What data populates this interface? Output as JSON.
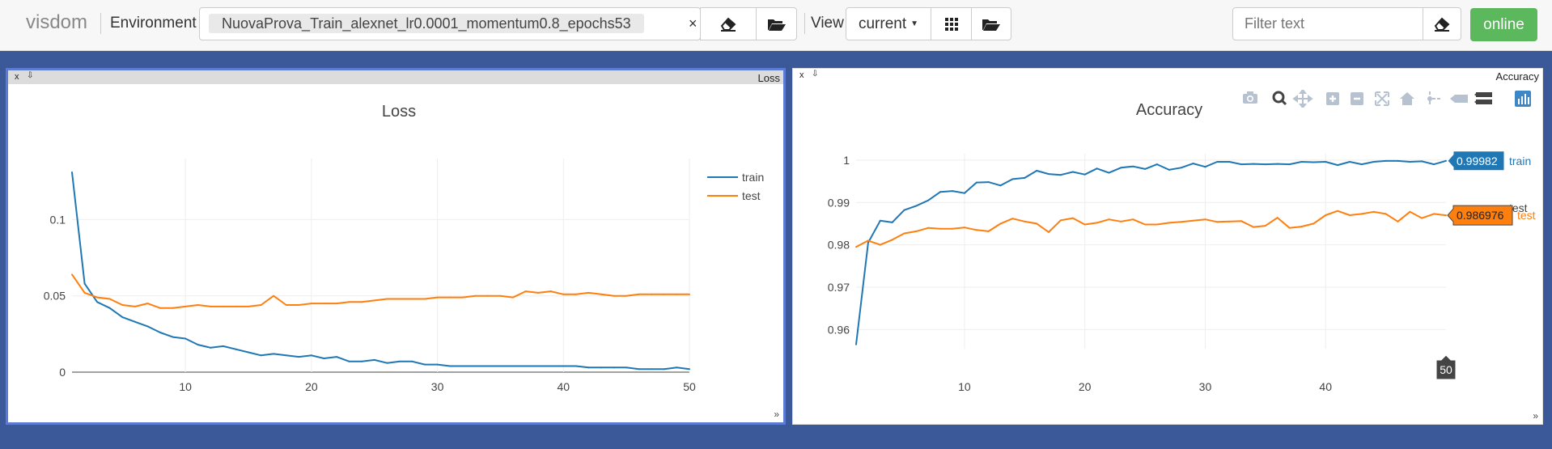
{
  "navbar": {
    "brand": "visdom",
    "environment_label": "Environment",
    "environment_value": "NuovaProva_Train_alexnet_lr0.0001_momentum0.8_epochs53",
    "clear_symbol": "×",
    "view_label": "View",
    "view_value": "current",
    "filter_placeholder": "Filter text",
    "online_label": "online"
  },
  "panels": [
    {
      "title": "Loss",
      "close": "x"
    },
    {
      "title": "Accuracy",
      "close": "x"
    }
  ],
  "colors": {
    "train": "#1f77b4",
    "test": "#ff7f0e",
    "background": "#3b5998",
    "online": "#5cb85c"
  },
  "icons": [
    "eraser-icon",
    "folder-open-icon",
    "grid-icon",
    "camera-icon",
    "zoom-icon",
    "pan-icon",
    "zoom-in-icon",
    "zoom-out-icon",
    "autoscale-icon",
    "home-icon",
    "spike-lines-icon",
    "hover-closest-icon",
    "hover-compare-icon",
    "plotly-logo-icon"
  ],
  "chart_data": [
    {
      "type": "line",
      "title": "Loss",
      "xlim": [
        1,
        50
      ],
      "ylim": [
        0,
        0.14
      ],
      "xticks": [
        10,
        20,
        30,
        40,
        50
      ],
      "yticks": [
        0,
        0.05,
        0.1
      ],
      "ytick_labels": [
        "0",
        "0.05",
        "0.1"
      ],
      "grid": true,
      "legend": "top-right",
      "x": [
        1,
        2,
        3,
        4,
        5,
        6,
        7,
        8,
        9,
        10,
        11,
        12,
        13,
        14,
        15,
        16,
        17,
        18,
        19,
        20,
        21,
        22,
        23,
        24,
        25,
        26,
        27,
        28,
        29,
        30,
        31,
        32,
        33,
        34,
        35,
        36,
        37,
        38,
        39,
        40,
        41,
        42,
        43,
        44,
        45,
        46,
        47,
        48,
        49,
        50
      ],
      "series": [
        {
          "name": "train",
          "values": [
            0.131,
            0.058,
            0.046,
            0.042,
            0.036,
            0.033,
            0.03,
            0.026,
            0.023,
            0.022,
            0.018,
            0.016,
            0.017,
            0.015,
            0.013,
            0.011,
            0.012,
            0.011,
            0.01,
            0.011,
            0.009,
            0.01,
            0.007,
            0.007,
            0.008,
            0.006,
            0.007,
            0.007,
            0.005,
            0.005,
            0.004,
            0.004,
            0.004,
            0.004,
            0.004,
            0.004,
            0.004,
            0.004,
            0.004,
            0.004,
            0.004,
            0.003,
            0.003,
            0.003,
            0.003,
            0.002,
            0.002,
            0.002,
            0.003,
            0.002
          ]
        },
        {
          "name": "test",
          "values": [
            0.064,
            0.052,
            0.049,
            0.048,
            0.044,
            0.043,
            0.045,
            0.042,
            0.042,
            0.043,
            0.044,
            0.043,
            0.043,
            0.043,
            0.043,
            0.044,
            0.05,
            0.044,
            0.044,
            0.045,
            0.045,
            0.045,
            0.046,
            0.046,
            0.047,
            0.048,
            0.048,
            0.048,
            0.048,
            0.049,
            0.049,
            0.049,
            0.05,
            0.05,
            0.05,
            0.049,
            0.053,
            0.052,
            0.053,
            0.051,
            0.051,
            0.052,
            0.051,
            0.05,
            0.05,
            0.051,
            0.051,
            0.051,
            0.051,
            0.051
          ]
        }
      ]
    },
    {
      "type": "line",
      "title": "Accuracy",
      "xlim": [
        1,
        50
      ],
      "ylim": [
        0.9555,
        1.0015
      ],
      "xticks": [
        10,
        20,
        30,
        40
      ],
      "yticks": [
        0.96,
        0.97,
        0.98,
        0.99,
        1
      ],
      "ytick_labels": [
        "0.96",
        "0.97",
        "0.98",
        "0.99",
        "1"
      ],
      "grid": true,
      "legend": "right",
      "hover_x_label": "50",
      "x": [
        1,
        2,
        3,
        4,
        5,
        6,
        7,
        8,
        9,
        10,
        11,
        12,
        13,
        14,
        15,
        16,
        17,
        18,
        19,
        20,
        21,
        22,
        23,
        24,
        25,
        26,
        27,
        28,
        29,
        30,
        31,
        32,
        33,
        34,
        35,
        36,
        37,
        38,
        39,
        40,
        41,
        42,
        43,
        44,
        45,
        46,
        47,
        48,
        49,
        50
      ],
      "series": [
        {
          "name": "train",
          "hover_value": "0.99982",
          "values": [
            0.9565,
            0.9805,
            0.9857,
            0.9853,
            0.9882,
            0.9892,
            0.9905,
            0.9925,
            0.9927,
            0.9922,
            0.9947,
            0.9948,
            0.994,
            0.9955,
            0.9958,
            0.9975,
            0.9967,
            0.9965,
            0.9972,
            0.9966,
            0.998,
            0.997,
            0.9982,
            0.9985,
            0.9979,
            0.999,
            0.9977,
            0.9982,
            0.9992,
            0.9984,
            0.9996,
            0.9996,
            0.999,
            0.9991,
            0.999,
            0.9991,
            0.999,
            0.9996,
            0.9995,
            0.9996,
            0.9988,
            0.9996,
            0.999,
            0.9996,
            0.9998,
            0.9998,
            0.9996,
            0.9997,
            0.999,
            0.99982
          ]
        },
        {
          "name": "test",
          "hover_value": "0.986976",
          "values": [
            0.9795,
            0.981,
            0.98,
            0.9812,
            0.9827,
            0.9832,
            0.984,
            0.9838,
            0.9838,
            0.9841,
            0.9835,
            0.9832,
            0.985,
            0.9862,
            0.9855,
            0.985,
            0.983,
            0.9858,
            0.9863,
            0.9848,
            0.9852,
            0.986,
            0.9855,
            0.986,
            0.9848,
            0.9848,
            0.9852,
            0.9854,
            0.9857,
            0.986,
            0.9854,
            0.9855,
            0.9856,
            0.9842,
            0.9845,
            0.9864,
            0.984,
            0.9843,
            0.985,
            0.987,
            0.988,
            0.987,
            0.9873,
            0.9878,
            0.9873,
            0.9855,
            0.9878,
            0.9863,
            0.9873,
            0.986976
          ]
        }
      ]
    }
  ]
}
